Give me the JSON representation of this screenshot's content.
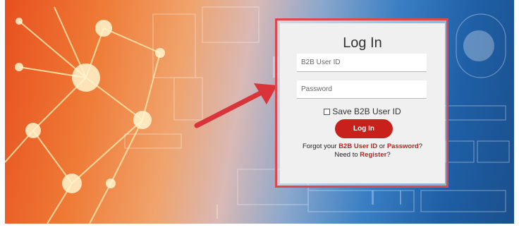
{
  "login": {
    "title": "Log In",
    "user_id_placeholder": "B2B User ID",
    "password_placeholder": "Password",
    "save_label": "Save B2B User ID",
    "button_label": "Log In",
    "forgot_prefix": "Forgot your ",
    "forgot_userid_link": "B2B User ID",
    "forgot_or": " or ",
    "forgot_password_link": "Password",
    "forgot_suffix": "?",
    "need_prefix": "Need to ",
    "register_link": "Register",
    "need_suffix": "?"
  },
  "colors": {
    "accent_red": "#c8211c",
    "panel_border": "#e0474c",
    "arrow_red": "#d8343a"
  }
}
